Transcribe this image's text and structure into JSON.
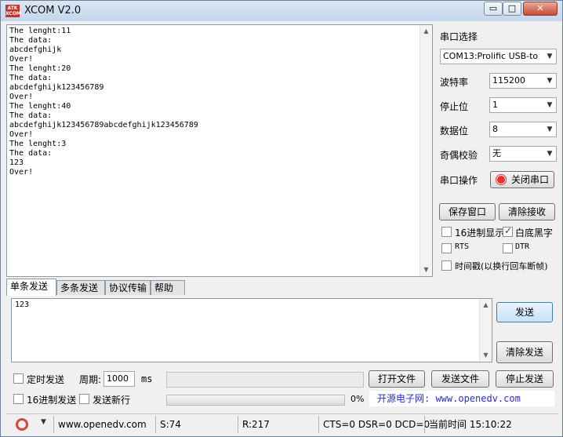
{
  "window": {
    "title": "XCOM V2.0",
    "logo_text": "ATK XCOM",
    "min_label": "▭",
    "max_label": "□",
    "close_label": "✕"
  },
  "receive": {
    "lines": [
      "The lenght:11",
      "The data:",
      "abcdefghijk",
      "Over!",
      "The lenght:20",
      "The data:",
      "abcdefghijk123456789",
      "Over!",
      "The lenght:40",
      "The data:",
      "abcdefghijk123456789abcdefghijk123456789",
      "Over!",
      "The lenght:3",
      "The data:",
      "123",
      "Over!"
    ]
  },
  "settings": {
    "port_select_label": "串口选择",
    "port_value": "COM13:Prolific USB-to",
    "baud_label": "波特率",
    "baud_value": "115200",
    "stop_label": "停止位",
    "stop_value": "1",
    "data_label": "数据位",
    "data_value": "8",
    "parity_label": "奇偶校验",
    "parity_value": "无",
    "port_op_label": "串口操作",
    "port_op_button": "关闭串口",
    "save_window": "保存窗口",
    "clear_receive": "清除接收",
    "hex_display": "16进制显示",
    "white_black": "白底黑字",
    "rts": "RTS",
    "dtr": "DTR",
    "timestamp": "时间戳(以换行回车断帧)"
  },
  "tabs": [
    "单条发送",
    "多条发送",
    "协议传输",
    "帮助"
  ],
  "send": {
    "text": "123",
    "send_button": "发送",
    "clear_send_button": "清除发送",
    "timed_send": "定时发送",
    "period_label": "周期:",
    "period_value": "1000",
    "ms_label": "ms",
    "open_file": "打开文件",
    "send_file": "发送文件",
    "stop_send": "停止发送",
    "hex_send": "16进制发送",
    "newline_send": "发送新行",
    "progress_text": "0%",
    "progress_value": 0,
    "site_link": "开源电子网: www.openedv.com"
  },
  "status": {
    "url": "www.openedv.com",
    "sent": "S:74",
    "received": "R:217",
    "signals": "CTS=0 DSR=0 DCD=0",
    "time": "当前时间 15:10:22"
  }
}
